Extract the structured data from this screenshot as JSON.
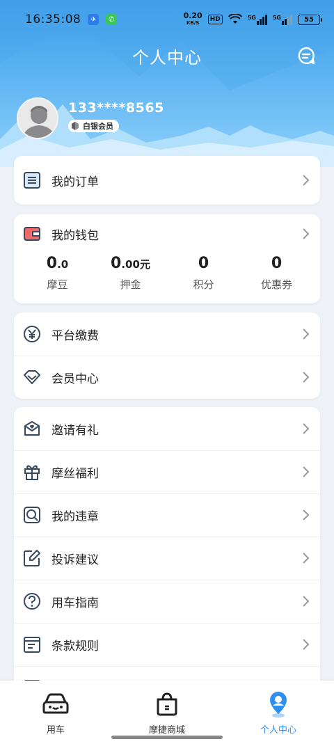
{
  "status_bar": {
    "time": "16:35:08",
    "net_speed": "0.20",
    "net_unit": "KB/S",
    "hd": "HD",
    "signal1": "5G",
    "signal2": "5G",
    "battery": "55"
  },
  "header": {
    "title": "个人中心",
    "message_icon": "chat-bubble-icon"
  },
  "profile": {
    "phone": "133****8565",
    "member_level": "白银会员"
  },
  "orders": {
    "label": "我的订单"
  },
  "wallet": {
    "label": "我的钱包",
    "stats": [
      {
        "value": "0",
        "decimal": ".0",
        "unit": "",
        "label": "摩豆"
      },
      {
        "value": "0",
        "decimal": ".00",
        "unit": "元",
        "label": "押金"
      },
      {
        "value": "0",
        "decimal": "",
        "unit": "",
        "label": "积分"
      },
      {
        "value": "0",
        "decimal": "",
        "unit": "",
        "label": "优惠券"
      }
    ]
  },
  "menu_group1": [
    {
      "label": "平台缴费",
      "icon": "yen-coin-icon"
    },
    {
      "label": "会员中心",
      "icon": "diamond-icon"
    }
  ],
  "menu_group2": [
    {
      "label": "邀请有礼",
      "icon": "envelope-heart-icon"
    },
    {
      "label": "摩丝福利",
      "icon": "gift-icon"
    },
    {
      "label": "我的违章",
      "icon": "violation-search-icon"
    },
    {
      "label": "投诉建议",
      "icon": "edit-icon"
    },
    {
      "label": "用车指南",
      "icon": "question-icon"
    },
    {
      "label": "条款规则",
      "icon": "document-icon"
    }
  ],
  "tabbar": [
    {
      "label": "用车",
      "icon": "car-icon",
      "active": false
    },
    {
      "label": "摩捷商城",
      "icon": "shopping-bag-icon",
      "active": false
    },
    {
      "label": "个人中心",
      "icon": "person-pin-icon",
      "active": true
    }
  ],
  "colors": {
    "accent": "#2f8ff0",
    "header_top": "#3a9be8",
    "header_bottom": "#8fd0fb",
    "wallet_icon": "#f06a6a",
    "background": "#eef1f5"
  }
}
